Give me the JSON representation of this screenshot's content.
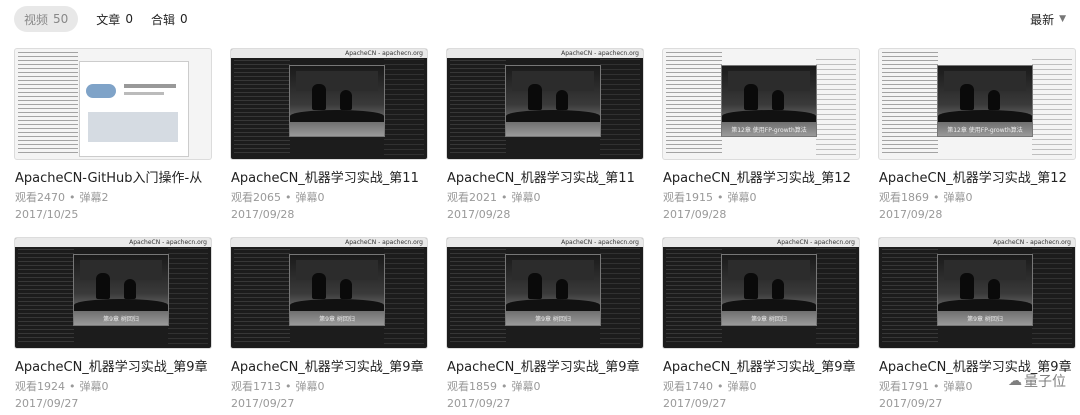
{
  "tabs": [
    {
      "label": "视频",
      "count": "50"
    },
    {
      "label": "文章",
      "count": "0"
    },
    {
      "label": "合辑",
      "count": "0"
    }
  ],
  "sort": {
    "label": "最新",
    "icon": "chevron-down-icon"
  },
  "videos": [
    {
      "title": "ApacheCN-GitHub入门操作-从",
      "views": "观看2470",
      "danmaku": "弹幕2",
      "date": "2017/10/25",
      "thumb": "web"
    },
    {
      "title": "ApacheCN_机器学习实战_第11",
      "views": "观看2065",
      "danmaku": "弹幕0",
      "date": "2017/09/28",
      "thumb": "dark",
      "thumb_header": "ApacheCN - apachecn.org"
    },
    {
      "title": "ApacheCN_机器学习实战_第11",
      "views": "观看2021",
      "danmaku": "弹幕0",
      "date": "2017/09/28",
      "thumb": "dark",
      "thumb_header": "ApacheCN - apachecn.org"
    },
    {
      "title": "ApacheCN_机器学习实战_第12",
      "views": "观看1915",
      "danmaku": "弹幕0",
      "date": "2017/09/28",
      "thumb": "light",
      "thumb_caption": "第12章 使用FP-growth算法"
    },
    {
      "title": "ApacheCN_机器学习实战_第12",
      "views": "观看1869",
      "danmaku": "弹幕0",
      "date": "2017/09/28",
      "thumb": "light",
      "thumb_caption": "第12章 使用FP-growth算法"
    },
    {
      "title": "ApacheCN_机器学习实战_第9章",
      "views": "观看1924",
      "danmaku": "弹幕0",
      "date": "2017/09/27",
      "thumb": "dark",
      "thumb_header": "ApacheCN - apachecn.org",
      "thumb_caption": "第9章 树回归"
    },
    {
      "title": "ApacheCN_机器学习实战_第9章",
      "views": "观看1713",
      "danmaku": "弹幕0",
      "date": "2017/09/27",
      "thumb": "dark",
      "thumb_header": "ApacheCN - apachecn.org",
      "thumb_caption": "第9章 树回归"
    },
    {
      "title": "ApacheCN_机器学习实战_第9章",
      "views": "观看1859",
      "danmaku": "弹幕0",
      "date": "2017/09/27",
      "thumb": "dark",
      "thumb_header": "ApacheCN - apachecn.org",
      "thumb_caption": "第9章 树回归"
    },
    {
      "title": "ApacheCN_机器学习实战_第9章",
      "views": "观看1740",
      "danmaku": "弹幕0",
      "date": "2017/09/27",
      "thumb": "dark",
      "thumb_header": "ApacheCN - apachecn.org",
      "thumb_caption": "第9章 树回归"
    },
    {
      "title": "ApacheCN_机器学习实战_第9章",
      "views": "观看1791",
      "danmaku": "弹幕0",
      "date": "2017/09/27",
      "thumb": "dark",
      "thumb_header": "ApacheCN - apachecn.org",
      "thumb_caption": "第9章 树回归"
    }
  ],
  "watermark": {
    "text": "量子位",
    "icon": "wechat-icon"
  }
}
